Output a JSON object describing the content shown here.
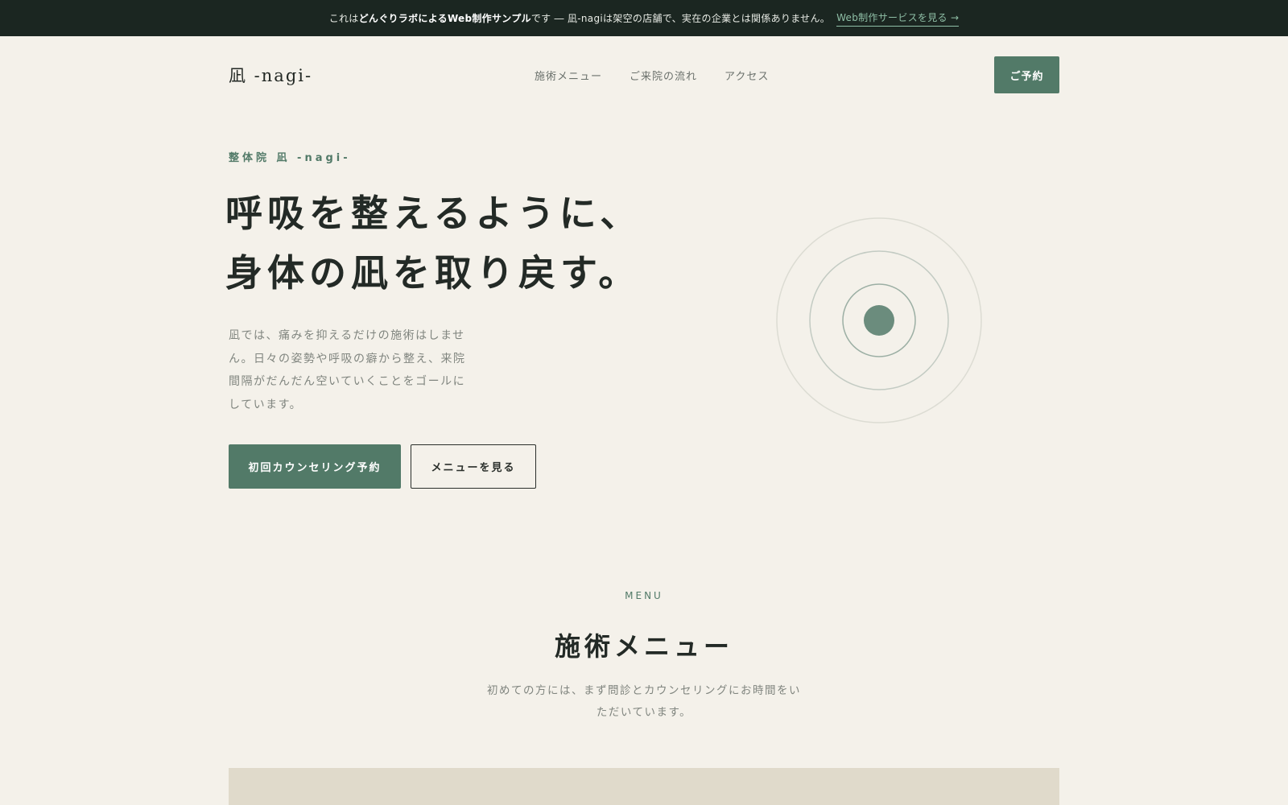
{
  "banner": {
    "prefix": "これは",
    "bold": "どんぐりラボによるWeb制作サンプル",
    "suffix": "です ― 凪-nagiは架空の店舗で、実在の企業とは関係ありません。",
    "link": "Web制作サービスを見る →"
  },
  "header": {
    "logo": "凪 -nagi-",
    "nav": [
      "施術メニュー",
      "ご来院の流れ",
      "アクセス"
    ],
    "reserve": "ご予約"
  },
  "hero": {
    "tag": "整体院 凪 -nagi-",
    "title_line1": "呼吸を整えるように、",
    "title_line2": "身体の凪を取り戻す。",
    "description": "凪では、痛みを抑えるだけの施術はしません。日々の姿勢や呼吸の癖から整え、来院間隔がだんだん空いていくことをゴールにしています。",
    "primary_button": "初回カウンセリング予約",
    "secondary_button": "メニューを見る"
  },
  "menu_section": {
    "eyebrow": "MENU",
    "title": "施術メニュー",
    "description": "初めての方には、まず問診とカウンセリングにお時間をいただいています。"
  },
  "colors": {
    "accent": "#527a68",
    "banner_bg": "#1b2621",
    "page_bg": "#f4f1ea",
    "card_bg": "#e0dacb"
  }
}
